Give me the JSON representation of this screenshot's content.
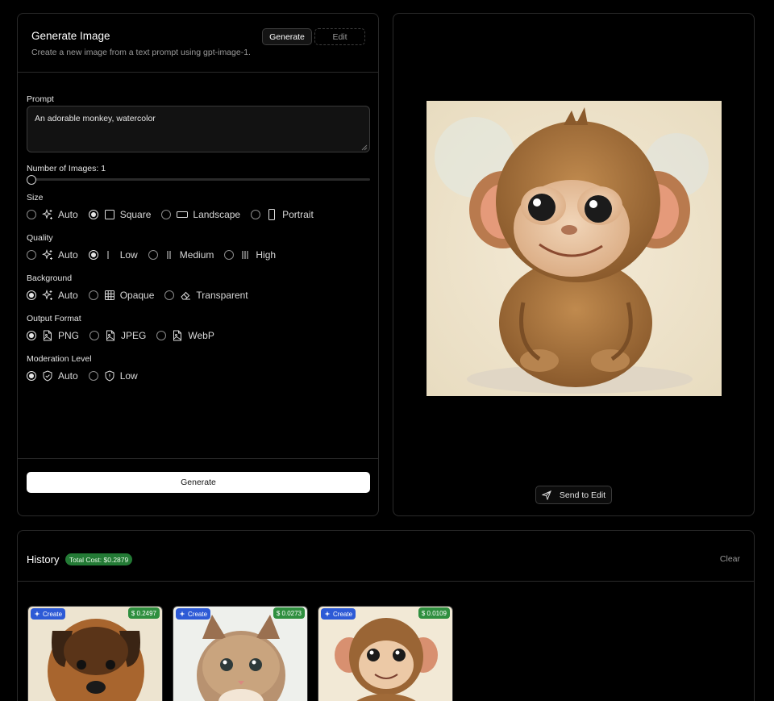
{
  "form": {
    "title": "Generate Image",
    "subtitle": "Create a new image from a text prompt using gpt-image-1.",
    "mode_generate": "Generate",
    "mode_edit": "Edit",
    "prompt_label": "Prompt",
    "prompt_value": "An adorable monkey, watercolor",
    "num_images_label": "Number of Images: 1",
    "num_images_value": 1,
    "size": {
      "label": "Size",
      "options": [
        "Auto",
        "Square",
        "Landscape",
        "Portrait"
      ],
      "selected": "Square"
    },
    "quality": {
      "label": "Quality",
      "options": [
        "Auto",
        "Low",
        "Medium",
        "High"
      ],
      "selected": "Low"
    },
    "background": {
      "label": "Background",
      "options": [
        "Auto",
        "Opaque",
        "Transparent"
      ],
      "selected": "Auto"
    },
    "output_format": {
      "label": "Output Format",
      "options": [
        "PNG",
        "JPEG",
        "WebP"
      ],
      "selected": "PNG"
    },
    "moderation": {
      "label": "Moderation Level",
      "options": [
        "Auto",
        "Low"
      ],
      "selected": "Auto"
    },
    "generate_button": "Generate"
  },
  "preview": {
    "send_to_edit": "Send to Edit"
  },
  "history": {
    "title": "History",
    "total_cost": "Total Cost: $0.2879",
    "clear": "Clear",
    "items": [
      {
        "tag": "Create",
        "cost": "$ 0.2497",
        "subject": "puppy-watercolor"
      },
      {
        "tag": "Create",
        "cost": "$ 0.0273",
        "subject": "kitten-watercolor"
      },
      {
        "tag": "Create",
        "cost": "$ 0.0109",
        "subject": "monkey-watercolor"
      }
    ]
  },
  "colors": {
    "background": "#000000",
    "border": "#2a2a2a",
    "cost_badge": "#237a35",
    "create_tag": "#2d5ad6",
    "primary_button": "#ffffff"
  }
}
